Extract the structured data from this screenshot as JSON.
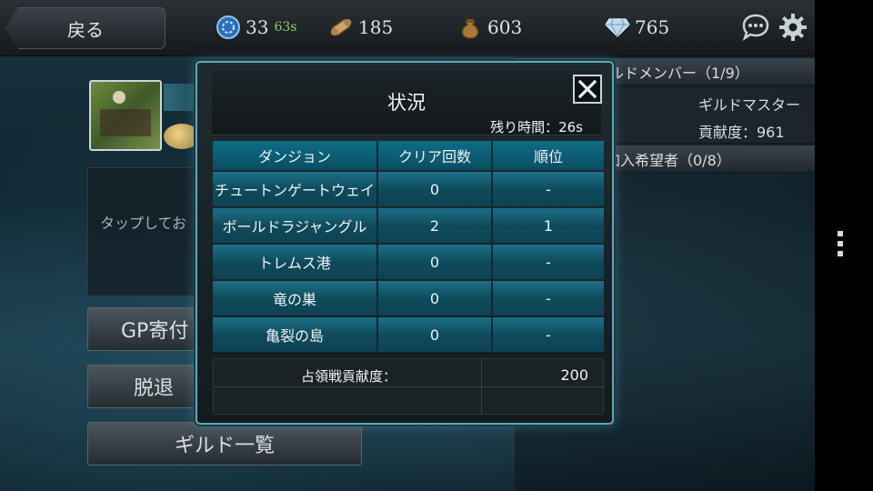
{
  "topbar": {
    "back_label": "戻る",
    "resources": [
      {
        "icon": "stamina-orb-icon",
        "value": "33",
        "sub": "63s"
      },
      {
        "icon": "scroll-icon",
        "value": "185"
      },
      {
        "icon": "gold-bag-icon",
        "value": "603"
      },
      {
        "icon": "diamond-icon",
        "value": "765"
      }
    ]
  },
  "background": {
    "notice_text": "タップしてお",
    "gp_button": "GP寄付",
    "leave_button": "脱退",
    "guild_list_button": "ギルド一覧",
    "members_label": "ルドメンバー（1/9）",
    "master_role": "ギルドマスター",
    "master_contribution": "貢献度：961",
    "applicants_label": "加入希望者（0/8）"
  },
  "dialog": {
    "title": "状況",
    "remaining_time": "残り時間：26s",
    "headers": [
      "ダンジョン",
      "クリア回数",
      "順位"
    ],
    "rows": [
      {
        "name": "チュートンゲートウェイ",
        "clears": "0",
        "rank": "-"
      },
      {
        "name": "ボールドラジャングル",
        "clears": "2",
        "rank": "1"
      },
      {
        "name": "トレムス港",
        "clears": "0",
        "rank": "-"
      },
      {
        "name": "竜の巣",
        "clears": "0",
        "rank": "-"
      },
      {
        "name": "亀裂の島",
        "clears": "0",
        "rank": "-"
      }
    ],
    "contribution_label": "占領戦貢献度：",
    "contribution_value": "200"
  },
  "colors": {
    "accent": "#5fa7b8",
    "table_cell": "#0f4b5c",
    "green_timer": "#8fd06a"
  }
}
